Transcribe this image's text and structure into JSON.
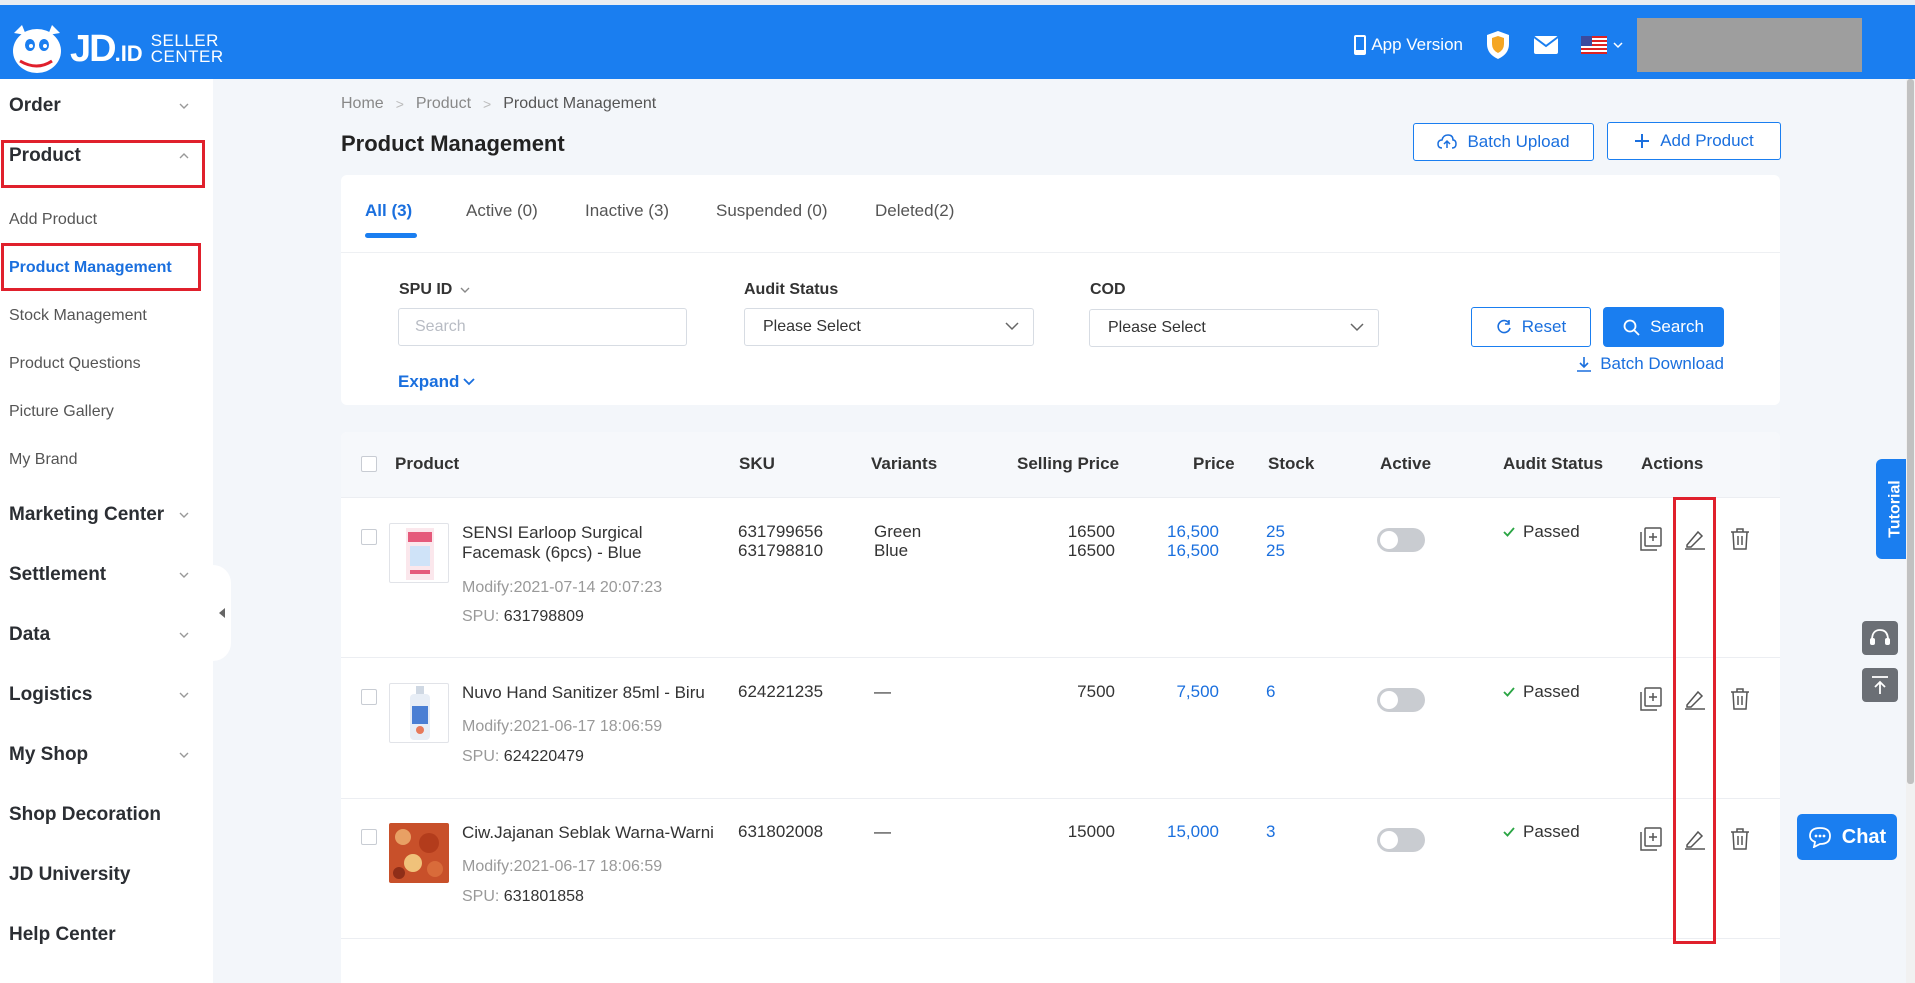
{
  "brand": {
    "jd": "JD",
    "id": ".ID",
    "seller_line1": "SELLER",
    "seller_line2": "CENTER"
  },
  "header": {
    "app_version": "App Version"
  },
  "sidebar": {
    "groups": [
      {
        "label": "Order"
      },
      {
        "label": "Product"
      },
      {
        "label": "Marketing Center"
      },
      {
        "label": "Settlement"
      },
      {
        "label": "Data"
      },
      {
        "label": "Logistics"
      },
      {
        "label": "My Shop"
      },
      {
        "label": "Shop Decoration"
      },
      {
        "label": "JD University"
      },
      {
        "label": "Help Center"
      }
    ],
    "product_items": [
      {
        "label": "Add Product"
      },
      {
        "label": "Product Management"
      },
      {
        "label": "Stock Management"
      },
      {
        "label": "Product Questions"
      },
      {
        "label": "Picture Gallery"
      },
      {
        "label": "My Brand"
      }
    ]
  },
  "breadcrumb": {
    "home": "Home",
    "product": "Product",
    "current": "Product Management"
  },
  "page": {
    "title": "Product Management",
    "batch_upload": "Batch Upload",
    "add_product": "Add Product"
  },
  "tabs": [
    {
      "label": "All (3)"
    },
    {
      "label": "Active (0)"
    },
    {
      "label": "Inactive (3)"
    },
    {
      "label": "Suspended (0)"
    },
    {
      "label": "Deleted(2)"
    }
  ],
  "filters": {
    "spu_label": "SPU ID",
    "spu_placeholder": "Search",
    "audit_label": "Audit Status",
    "audit_value": "Please Select",
    "cod_label": "COD",
    "cod_value": "Please Select",
    "reset": "Reset",
    "search": "Search",
    "expand": "Expand",
    "batch_download": "Batch Download"
  },
  "table": {
    "headers": {
      "product": "Product",
      "sku": "SKU",
      "variants": "Variants",
      "selling_price": "Selling Price",
      "price": "Price",
      "stock": "Stock",
      "active": "Active",
      "audit": "Audit Status",
      "actions": "Actions"
    },
    "modify_prefix": "Modify:",
    "spu_prefix": "SPU: ",
    "rows": [
      {
        "name": "SENSI Earloop Surgical Facemask (6pcs) - Blue",
        "modify": "Modify:2021-07-14 20:07:23",
        "spu_label": "SPU:",
        "spu": "631798809",
        "sku": [
          "631799656",
          "631798810"
        ],
        "variants": [
          "Green",
          "Blue"
        ],
        "selling_price": [
          "16500",
          "16500"
        ],
        "price": [
          "16,500",
          "16,500"
        ],
        "stock": [
          "25",
          "25"
        ],
        "active": false,
        "audit": "Passed"
      },
      {
        "name": "Nuvo Hand Sanitizer 85ml - Biru",
        "modify": "Modify:2021-06-17 18:06:59",
        "spu_label": "SPU:",
        "spu": "624220479",
        "sku": [
          "624221235"
        ],
        "variants": [
          "—"
        ],
        "selling_price": [
          "7500"
        ],
        "price": [
          "7,500"
        ],
        "stock": [
          "6"
        ],
        "active": false,
        "audit": "Passed"
      },
      {
        "name": "Ciw.Jajanan Seblak Warna-Warni",
        "modify": "Modify:2021-06-17 18:06:59",
        "spu_label": "SPU:",
        "spu": "631801858",
        "sku": [
          "631802008"
        ],
        "variants": [
          "—"
        ],
        "selling_price": [
          "15000"
        ],
        "price": [
          "15,000"
        ],
        "stock": [
          "3"
        ],
        "active": false,
        "audit": "Passed"
      }
    ]
  },
  "floating": {
    "tutorial": "Tutorial",
    "chat": "Chat"
  },
  "colors": {
    "brand_blue": "#1a7ef0",
    "highlight_red": "#e0202c",
    "passed_green": "#2aa544"
  }
}
